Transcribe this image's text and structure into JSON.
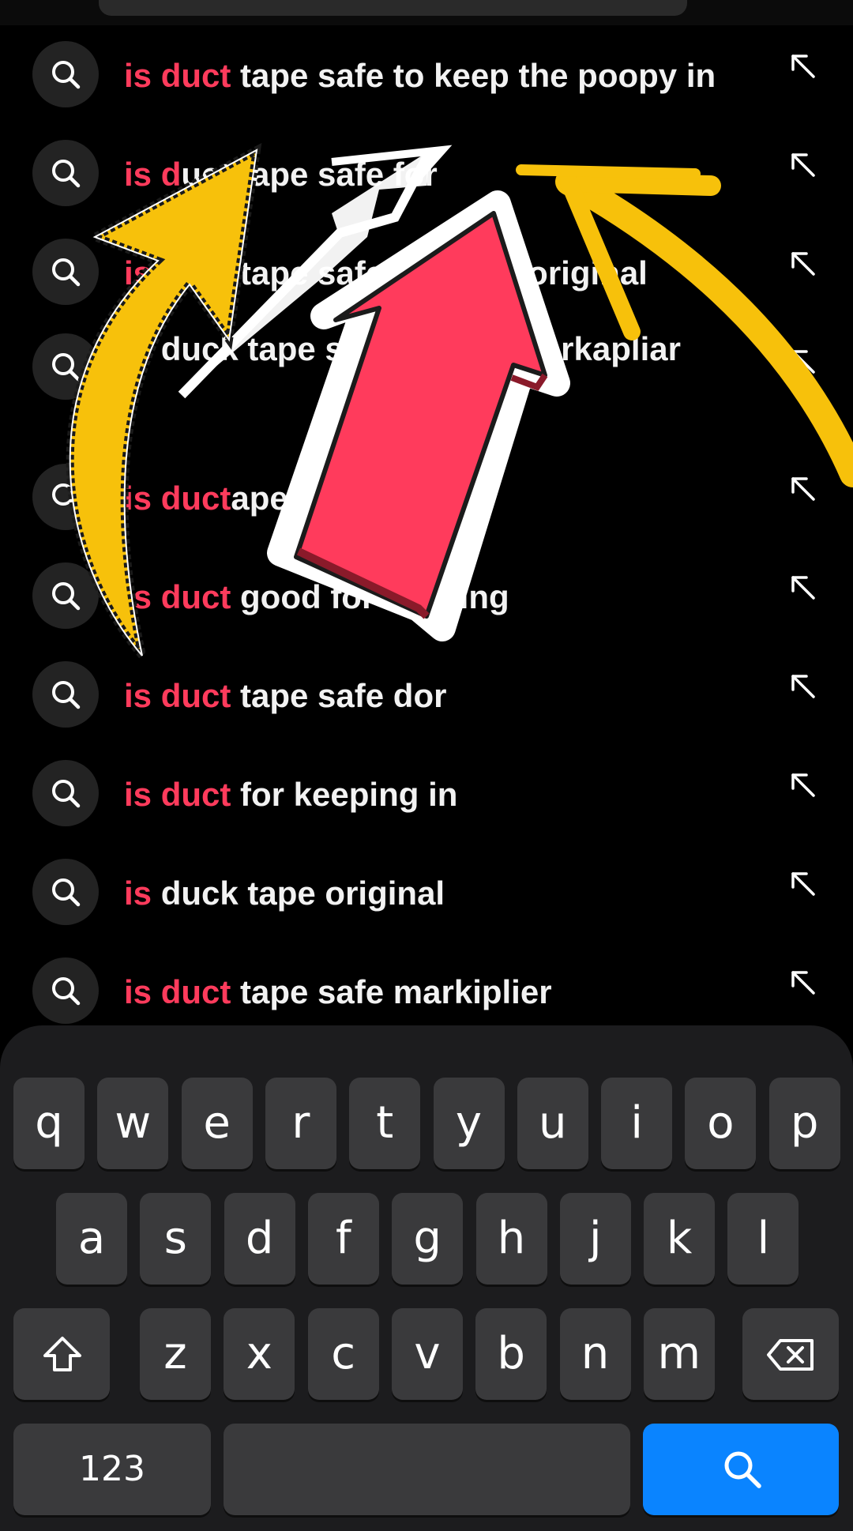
{
  "suggestions": [
    {
      "highlight": "is duct",
      "rest": " tape safe to keep the poopy in"
    },
    {
      "highlight": "is d",
      "rest": "uct tape safe for"
    },
    {
      "highlight": "is duct",
      "rest": " tape safe keeping original"
    },
    {
      "highlight": "is",
      "rest": " duck tape safe for the markapliar"
    },
    {
      "highlight": "is duct",
      "rest": "ape"
    },
    {
      "highlight": "is duct",
      "rest": " good for keeping"
    },
    {
      "highlight": "is duct",
      "rest": " tape safe dor"
    },
    {
      "highlight": "is duct",
      "rest": " for keeping in"
    },
    {
      "highlight": "is",
      "rest": " duck tape original"
    },
    {
      "highlight": "is duct",
      "rest": " tape safe markiplier"
    }
  ],
  "keyboard": {
    "row1": [
      "q",
      "w",
      "e",
      "r",
      "t",
      "y",
      "u",
      "i",
      "o",
      "p"
    ],
    "row2": [
      "a",
      "s",
      "d",
      "f",
      "g",
      "h",
      "j",
      "k",
      "l"
    ],
    "row3": [
      "z",
      "x",
      "c",
      "v",
      "b",
      "n",
      "m"
    ],
    "numbers_label": "123"
  },
  "colors": {
    "highlight": "#ff3b5c",
    "search_key": "#0a84ff",
    "yellow_arrow": "#f7c10b",
    "red_arrow": "#ff3b5c"
  },
  "icons": {
    "suggestion": "search-icon",
    "fill": "arrow-up-left-icon",
    "shift": "shift-icon",
    "delete": "backspace-icon",
    "search_key": "search-icon"
  }
}
